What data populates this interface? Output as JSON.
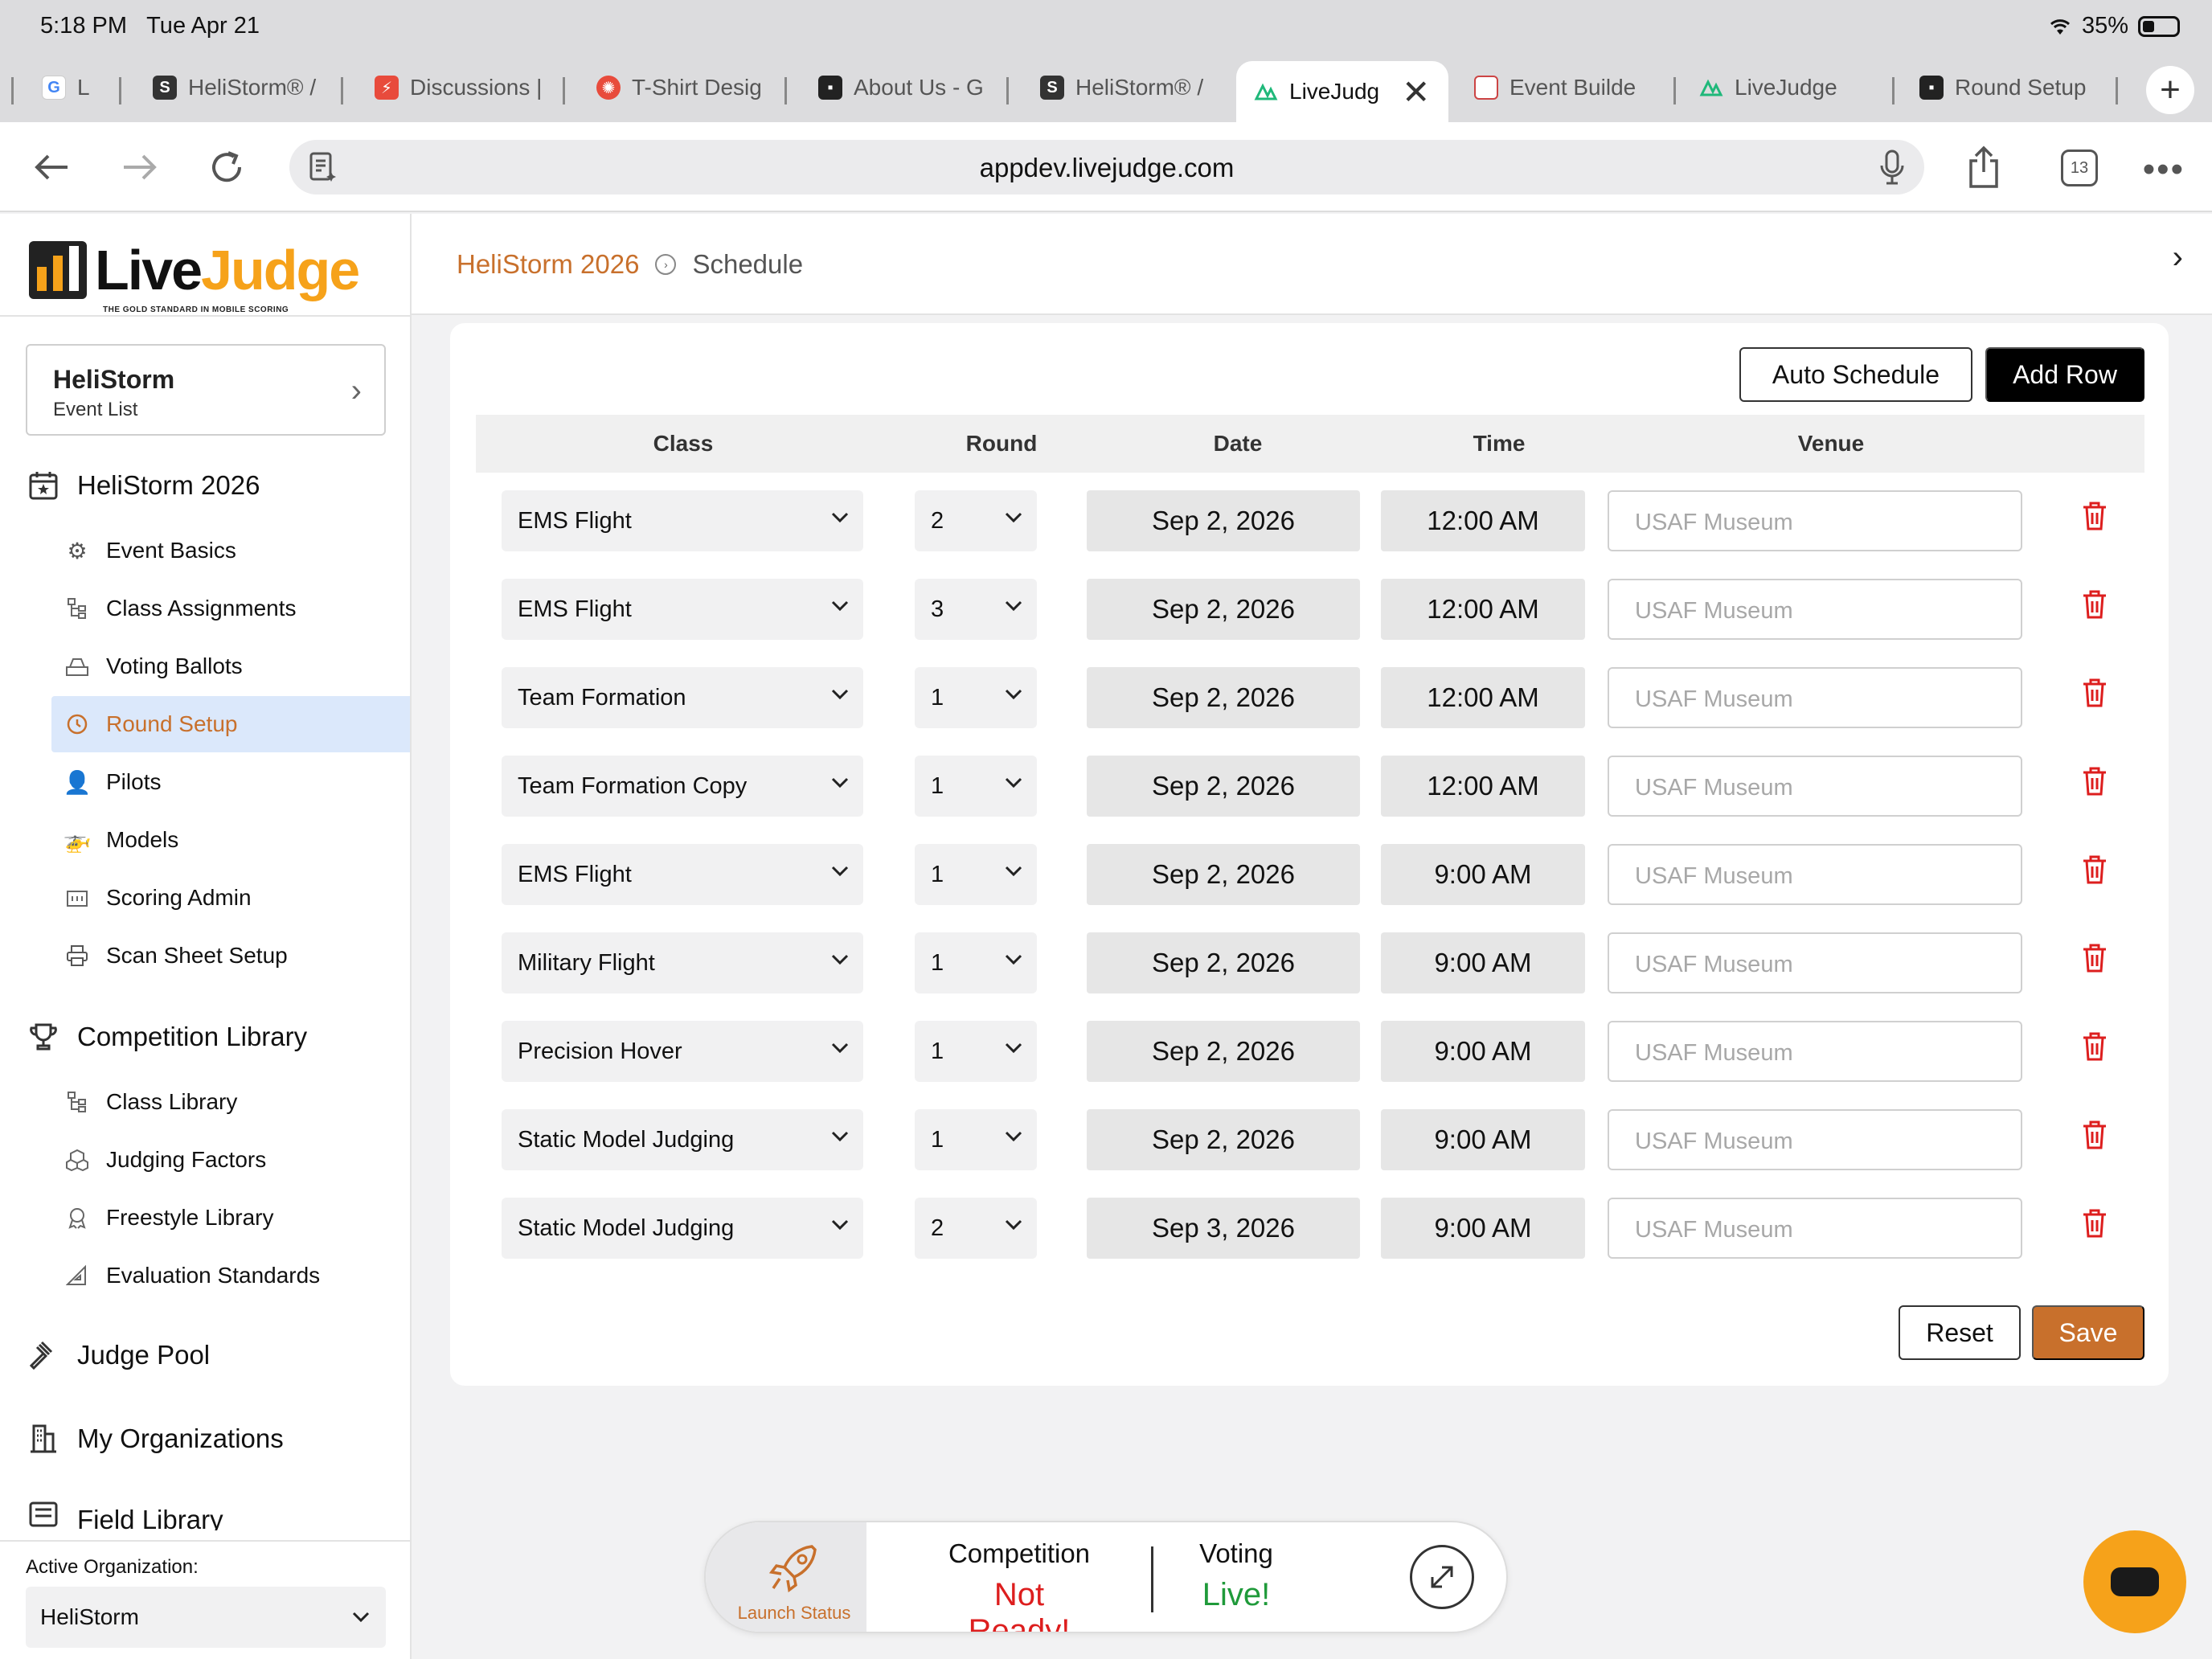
{
  "status_bar": {
    "time": "5:18 PM",
    "date": "Tue Apr 21",
    "battery": "35%"
  },
  "tabs": [
    {
      "label": "L",
      "icon": "google-icon",
      "x": 30,
      "w": 120
    },
    {
      "label": "HeliStorm® /",
      "icon": "helistorm-icon"
    },
    {
      "label": "Discussions |",
      "icon": "discussions-icon"
    },
    {
      "label": "T-Shirt Desig",
      "icon": "tshirt-icon"
    },
    {
      "label": "About Us - G",
      "icon": "aboutus-icon"
    },
    {
      "label": "HeliStorm® /",
      "icon": "helistorm-icon"
    },
    {
      "label": "LiveJudg",
      "icon": "livejudge-icon",
      "active": true
    },
    {
      "label": "Event Builde",
      "icon": "event-builder-icon"
    },
    {
      "label": "LiveJudge",
      "icon": "livejudge-icon"
    },
    {
      "label": "Round Setup",
      "icon": "round-setup-icon"
    }
  ],
  "address_bar": {
    "url": "appdev.livejudge.com",
    "tab_count": "13"
  },
  "logo": {
    "live": "Live",
    "judge": "Judge",
    "tagline": "THE GOLD STANDARD IN MOBILE SCORING"
  },
  "event_card": {
    "title": "HeliStorm",
    "subtitle": "Event List"
  },
  "nav": {
    "event_title": "HeliStorm 2026",
    "event_items": [
      "Event Basics",
      "Class Assignments",
      "Voting Ballots",
      "Round Setup",
      "Pilots",
      "Models",
      "Scoring Admin",
      "Scan Sheet Setup"
    ],
    "library_title": "Competition Library",
    "library_items": [
      "Class Library",
      "Judging Factors",
      "Freestyle Library",
      "Evaluation Standards"
    ],
    "judge_pool": "Judge Pool",
    "my_orgs": "My Organizations",
    "field_library": "Field Library"
  },
  "active_org": {
    "label": "Active Organization:",
    "value": "HeliStorm"
  },
  "breadcrumb": {
    "event": "HeliStorm 2026",
    "page": "Schedule"
  },
  "actions": {
    "auto_schedule": "Auto Schedule",
    "add_row": "Add Row",
    "reset": "Reset",
    "save": "Save"
  },
  "table": {
    "headers": {
      "class": "Class",
      "round": "Round",
      "date": "Date",
      "time": "Time",
      "venue": "Venue"
    },
    "venue_placeholder": "USAF Museum",
    "rows": [
      {
        "class": "EMS Flight",
        "round": "2",
        "date": "Sep 2, 2026",
        "time": "12:00 AM"
      },
      {
        "class": "EMS Flight",
        "round": "3",
        "date": "Sep 2, 2026",
        "time": "12:00 AM"
      },
      {
        "class": "Team Formation",
        "round": "1",
        "date": "Sep 2, 2026",
        "time": "12:00 AM"
      },
      {
        "class": "Team Formation Copy",
        "round": "1",
        "date": "Sep 2, 2026",
        "time": "12:00 AM"
      },
      {
        "class": "EMS Flight",
        "round": "1",
        "date": "Sep 2, 2026",
        "time": "9:00 AM"
      },
      {
        "class": "Military Flight",
        "round": "1",
        "date": "Sep 2, 2026",
        "time": "9:00 AM"
      },
      {
        "class": "Precision Hover",
        "round": "1",
        "date": "Sep 2, 2026",
        "time": "9:00 AM"
      },
      {
        "class": "Static Model Judging",
        "round": "1",
        "date": "Sep 2, 2026",
        "time": "9:00 AM"
      },
      {
        "class": "Static Model Judging",
        "round": "2",
        "date": "Sep 3, 2026",
        "time": "9:00 AM"
      }
    ]
  },
  "launch": {
    "label": "Launch Status",
    "competition_label": "Competition",
    "competition_status": "Not Ready!",
    "voting_label": "Voting",
    "voting_status": "Live!"
  },
  "colors": {
    "accent": "#c8702c",
    "brand_yellow": "#f6a21a",
    "danger": "#dd1e1e",
    "success": "#1f9a3a",
    "active_nav_bg": "#dbe8fb"
  }
}
